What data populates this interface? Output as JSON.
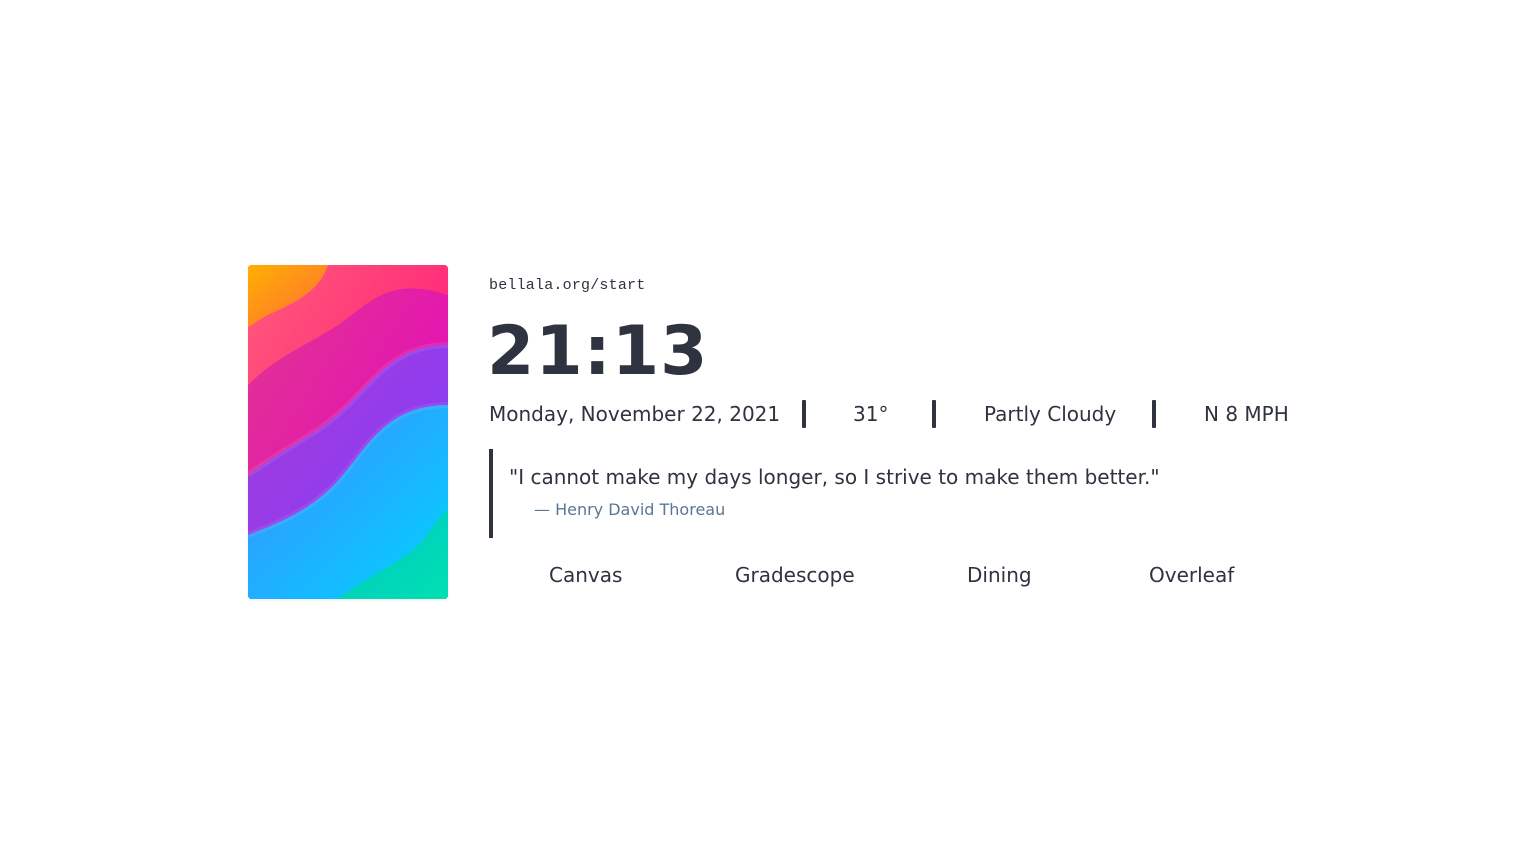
{
  "site_url": "bellala.org/start",
  "clock": "21:13",
  "info": {
    "date": "Monday, November 22, 2021",
    "temperature": "31°",
    "condition": "Partly Cloudy",
    "wind": "N 8 MPH"
  },
  "quote": {
    "text": "\"I cannot make my days longer, so I strive to make them better.\"",
    "author": "— Henry David Thoreau"
  },
  "links": [
    {
      "label": "Canvas"
    },
    {
      "label": "Gradescope"
    },
    {
      "label": "Dining"
    },
    {
      "label": "Overleaf"
    }
  ],
  "colors": {
    "text": "#2f3340",
    "author": "#5b7693",
    "background": "#ffffff"
  }
}
